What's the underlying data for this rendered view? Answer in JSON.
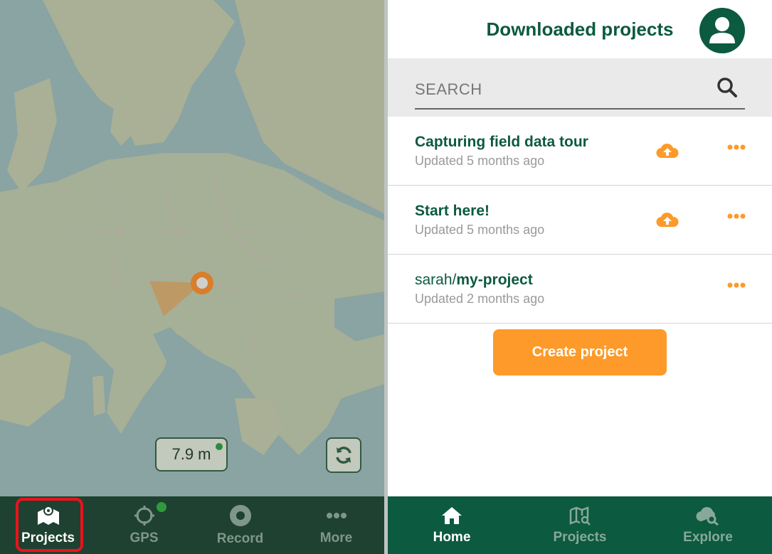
{
  "map_panel": {
    "gps_accuracy": "7.9 m",
    "nav": [
      {
        "label": "Projects",
        "icon": "map-pin-icon",
        "active": true
      },
      {
        "label": "GPS",
        "icon": "crosshair-icon",
        "active": false
      },
      {
        "label": "Record",
        "icon": "record-icon",
        "active": false
      },
      {
        "label": "More",
        "icon": "more-dots-icon",
        "active": false
      }
    ]
  },
  "app_panel": {
    "title": "Downloaded projects",
    "search": {
      "placeholder": "SEARCH",
      "value": ""
    },
    "projects": [
      {
        "namespace": "",
        "name": "Capturing field data tour",
        "updated": "Updated 5 months ago",
        "has_upload": true
      },
      {
        "namespace": "",
        "name": "Start here!",
        "updated": "Updated 5 months ago",
        "has_upload": true
      },
      {
        "namespace": "sarah/",
        "name": "my-project",
        "updated": "Updated 2 months ago",
        "has_upload": false
      }
    ],
    "create_button": "Create project",
    "nav": [
      {
        "label": "Home",
        "icon": "home-icon",
        "active": true
      },
      {
        "label": "Projects",
        "icon": "map-search-icon",
        "active": false
      },
      {
        "label": "Explore",
        "icon": "cloud-search-icon",
        "active": false
      }
    ]
  },
  "colors": {
    "brand_green": "#0c5a3f",
    "accent_orange": "#fd9a29",
    "map_nav_bg": "#1f4131",
    "active_highlight": "#e8141c"
  }
}
